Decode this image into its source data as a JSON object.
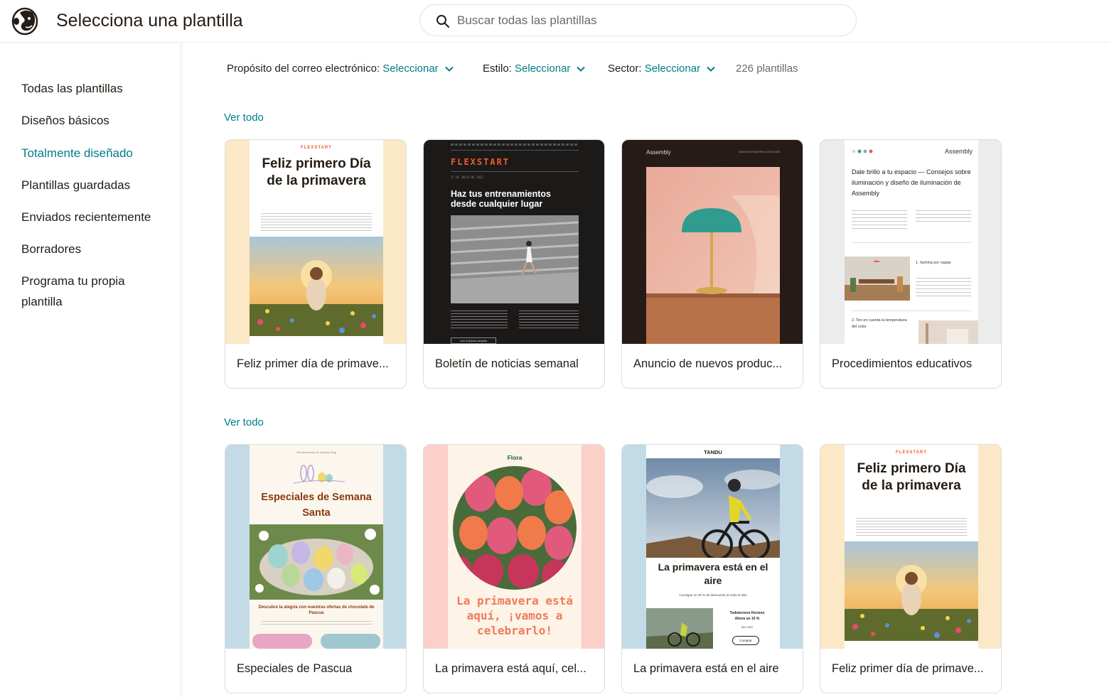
{
  "header": {
    "title": "Selecciona una plantilla",
    "search_placeholder": "Buscar todas las plantillas"
  },
  "sidebar": {
    "items": [
      {
        "label": "Todas las plantillas",
        "active": false
      },
      {
        "label": "Diseños básicos",
        "active": false
      },
      {
        "label": "Totalmente diseñado",
        "active": true
      },
      {
        "label": "Plantillas guardadas",
        "active": false
      },
      {
        "label": "Enviados recientemente",
        "active": false
      },
      {
        "label": "Borradores",
        "active": false
      },
      {
        "label": "Programa tu propia plantilla",
        "active": false
      }
    ]
  },
  "filters": {
    "purpose_label": "Propósito del correo electrónico:",
    "purpose_value": "Seleccionar",
    "style_label": "Estilo:",
    "style_value": "Seleccionar",
    "sector_label": "Sector:",
    "sector_value": "Seleccionar",
    "count": "226 plantillas"
  },
  "sections": [
    {
      "see_all": "Ver todo",
      "cards": [
        {
          "caption": "Feliz primer día de primave...",
          "thumb": {
            "brand": "FLEXSTART",
            "heading": "Feliz primero Día de la primavera"
          }
        },
        {
          "caption": "Boletín de noticias semanal",
          "thumb": {
            "brand": "FLEXSTART",
            "date": "17 DE JULIO DE 2023",
            "heading": "Haz tus entrenamientos desde cualquier lugar",
            "button": "Leer la historia completa"
          }
        },
        {
          "caption": "Anuncio de nuevos produc...",
          "thumb": {
            "brand": "Assembly",
            "nav": "NUEVO EN NUESTRA COLECCIÓN"
          }
        },
        {
          "caption": "Procedimientos educativos",
          "thumb": {
            "brand": "Assembly",
            "heading": "Dale brillo a tu espacio — Consejos sobre iluminación y diseño de iluminación de Assembly",
            "sub1": "1. Ilumina por capas",
            "sub2": "2. Ten en cuenta la temperatura del color"
          }
        }
      ]
    },
    {
      "see_all": "Ver todo",
      "cards": [
        {
          "caption": "Especiales de Pascua",
          "thumb": {
            "top": "Tienda Avance de Noticias Blog",
            "heading": "Especiales de Semana Santa",
            "sub": "Descubre la alegría con nuestras ofertas de chocolate de Pascua"
          }
        },
        {
          "caption": "La primavera está aquí, cel...",
          "thumb": {
            "brand": "Flora",
            "heading": "La primavera está aquí, ¡vamos a celebrarlo!"
          }
        },
        {
          "caption": "La primavera está en el aire",
          "thumb": {
            "brand": "TANDU",
            "heading": "La primavera está en el aire",
            "sub": "Consigue un 25 % de descuento en todo el sitio",
            "product": "Todoterreno Horizon",
            "offer": "Ahora un 15 %",
            "price": "850 USD",
            "button": "Comprar"
          }
        },
        {
          "caption": "Feliz primer día de primave...",
          "thumb": {
            "brand": "FLEXSTART",
            "heading": "Feliz primero Día de la primavera"
          }
        }
      ]
    }
  ],
  "colors": {
    "accent": "#007c89",
    "text": "#241c15",
    "muted": "#6a6a6a",
    "flexstart_orange": "#f25c2a"
  },
  "icons": {
    "logo": "mailchimp-freddie-logo",
    "search": "search-icon",
    "chevron": "chevron-down-icon"
  }
}
